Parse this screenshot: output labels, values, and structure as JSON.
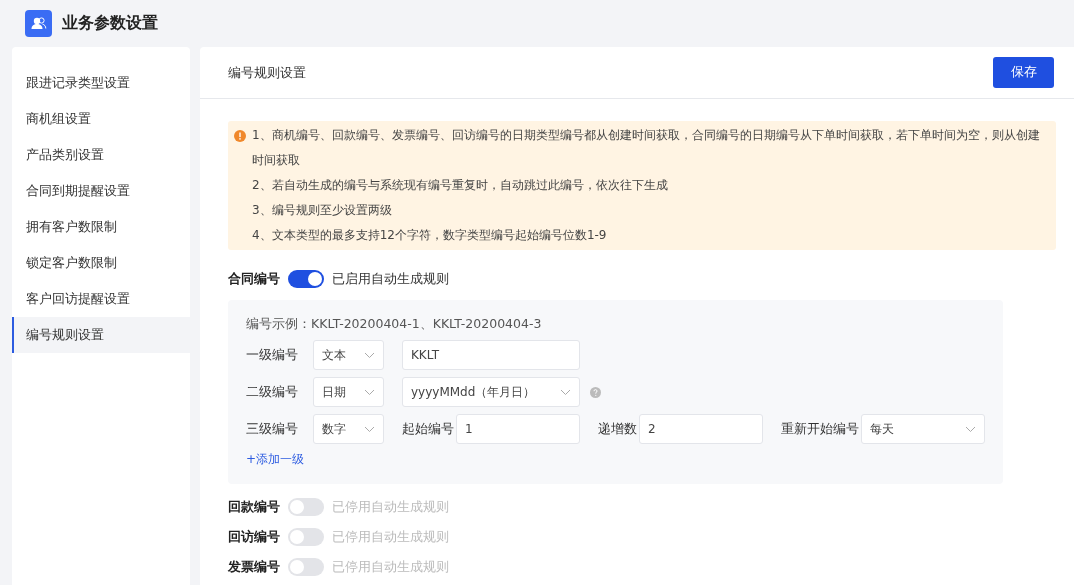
{
  "app": {
    "title": "业务参数设置"
  },
  "sidebar": {
    "items": [
      {
        "label": "跟进记录类型设置",
        "selected": false
      },
      {
        "label": "商机组设置",
        "selected": false
      },
      {
        "label": "产品类别设置",
        "selected": false
      },
      {
        "label": "合同到期提醒设置",
        "selected": false
      },
      {
        "label": "拥有客户数限制",
        "selected": false
      },
      {
        "label": "锁定客户数限制",
        "selected": false
      },
      {
        "label": "客户回访提醒设置",
        "selected": false
      },
      {
        "label": "编号规则设置",
        "selected": true
      }
    ]
  },
  "panel": {
    "title": "编号规则设置",
    "save_button": "保存"
  },
  "notice": [
    "1、商机编号、回款编号、发票编号、回访编号的日期类型编号都从创建时间获取，合同编号的日期编号从下单时间获取，若下单时间为空，则从创建时间获取",
    "2、若自动生成的编号与系统现有编号重复时，自动跳过此编号，依次往下生成",
    "3、编号规则至少设置两级",
    "4、文本类型的最多支持12个字符，数字类型编号起始编号位数1-9"
  ],
  "rules": [
    {
      "label": "合同编号",
      "on": true,
      "status": "已启用自动生成规则",
      "config": {
        "example": "编号示例：KKLT-20200404-1、KKLT-20200404-3",
        "levels": [
          {
            "label": "一级编号",
            "type": "文本",
            "kind": "text",
            "value": "KKLT"
          },
          {
            "label": "二级编号",
            "type": "日期",
            "kind": "date",
            "format": "yyyyMMdd（年月日）"
          },
          {
            "label": "三级编号",
            "type": "数字",
            "kind": "number",
            "start_label": "起始编号",
            "start": "1",
            "step_label": "递增数",
            "step": "2",
            "reset_label": "重新开始编号",
            "reset": "每天"
          }
        ],
        "add_link": "+添加一级"
      }
    },
    {
      "label": "回款编号",
      "on": false,
      "status": "已停用自动生成规则"
    },
    {
      "label": "回访编号",
      "on": false,
      "status": "已停用自动生成规则"
    },
    {
      "label": "发票编号",
      "on": false,
      "status": "已停用自动生成规则"
    }
  ]
}
